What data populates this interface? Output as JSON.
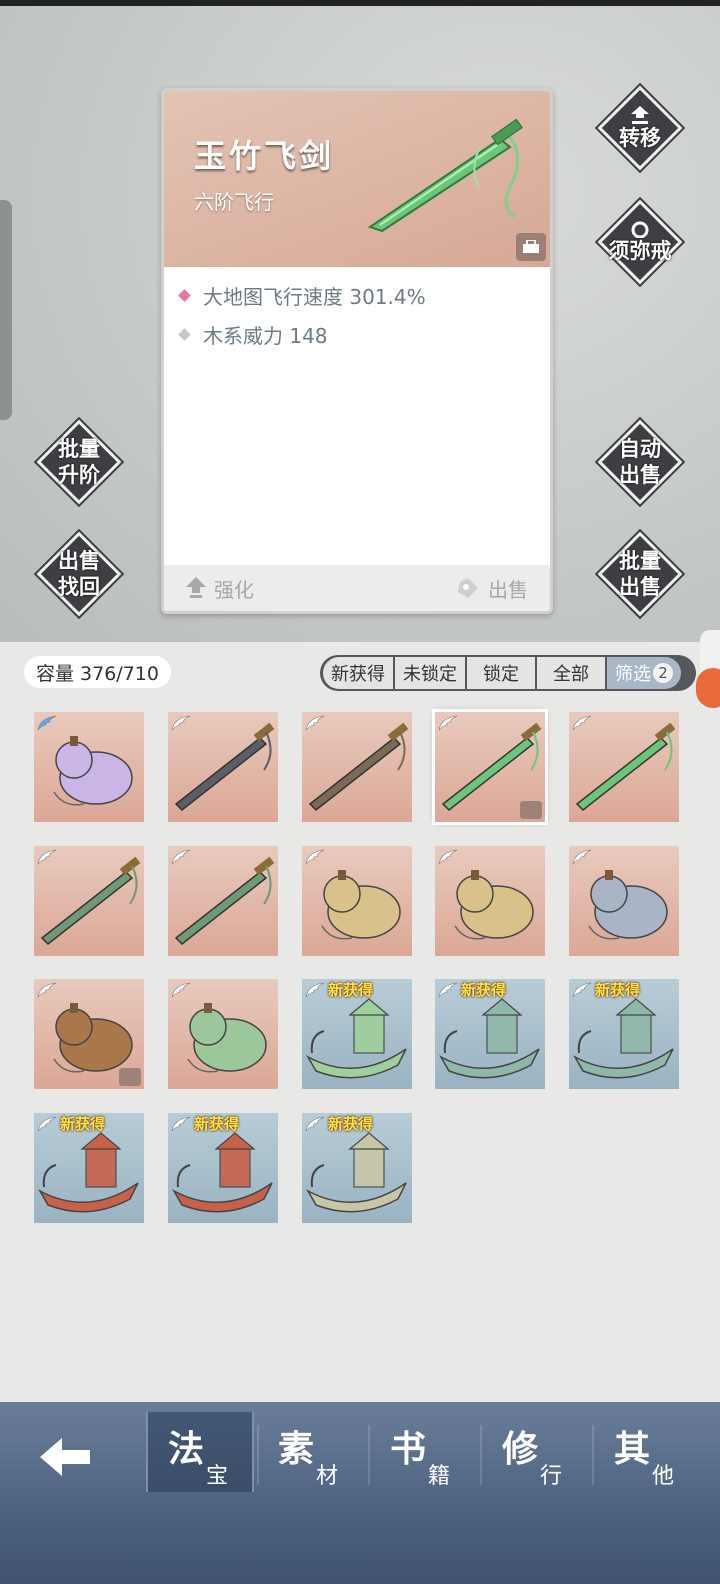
{
  "detail": {
    "name": "玉竹飞剑",
    "type": "六阶飞行",
    "stats": [
      {
        "text": "大地图飞行速度 301.4%",
        "color": "#e07aa8"
      },
      {
        "text": "木系威力 148",
        "color": "#c8c8c8"
      }
    ],
    "enhance_label": "强化",
    "sell_label": "出售"
  },
  "side_buttons": {
    "transfer": "转移",
    "sumeru_ring": "须弥戒",
    "batch_upgrade_1": "批量",
    "batch_upgrade_2": "升阶",
    "auto_sell_1": "自动",
    "auto_sell_2": "出售",
    "sell_recover_1": "出售",
    "sell_recover_2": "找回",
    "batch_sell_1": "批量",
    "batch_sell_2": "出售"
  },
  "inventory": {
    "capacity": "容量 376/710",
    "filters": [
      "新获得",
      "未锁定",
      "锁定",
      "全部",
      "筛选"
    ],
    "filter_count": "2",
    "new_tag": "新获得",
    "items": [
      {
        "icon": "gourd-purple-icon",
        "bg": "pink",
        "wing": "blue",
        "new": false,
        "locked": false
      },
      {
        "icon": "dark-sword-icon",
        "bg": "pink",
        "wing": "white",
        "new": false,
        "locked": false
      },
      {
        "icon": "bronze-sword-icon",
        "bg": "pink",
        "wing": "white",
        "new": false,
        "locked": false
      },
      {
        "icon": "jade-sword-icon",
        "bg": "pink",
        "wing": "white",
        "new": false,
        "locked": true,
        "selected": true
      },
      {
        "icon": "jade-sword-icon",
        "bg": "pink",
        "wing": "white",
        "new": false,
        "locked": false
      },
      {
        "icon": "green-sword-icon",
        "bg": "pink",
        "wing": "white",
        "new": false,
        "locked": false
      },
      {
        "icon": "green-sword-icon",
        "bg": "pink",
        "wing": "white",
        "new": false,
        "locked": false
      },
      {
        "icon": "golden-gourd-icon",
        "bg": "pink",
        "wing": "white",
        "new": false,
        "locked": false
      },
      {
        "icon": "golden-gourd-icon",
        "bg": "pink",
        "wing": "white",
        "new": false,
        "locked": false
      },
      {
        "icon": "blue-gourd-icon",
        "bg": "pink",
        "wing": "white",
        "new": false,
        "locked": false
      },
      {
        "icon": "wine-gourd-icon",
        "bg": "pink",
        "wing": "white",
        "new": false,
        "locked": true
      },
      {
        "icon": "green-gourd-icon",
        "bg": "pink",
        "wing": "white",
        "new": false,
        "locked": false
      },
      {
        "icon": "jade-boat-icon",
        "bg": "blue",
        "wing": "white",
        "new": true,
        "locked": false
      },
      {
        "icon": "pavilion-boat-icon",
        "bg": "blue",
        "wing": "white",
        "new": true,
        "locked": false
      },
      {
        "icon": "pavilion-boat-icon",
        "bg": "blue",
        "wing": "white",
        "new": true,
        "locked": false
      },
      {
        "icon": "red-boat-icon",
        "bg": "blue",
        "wing": "white",
        "new": true,
        "locked": false
      },
      {
        "icon": "red-boat-icon",
        "bg": "blue",
        "wing": "white",
        "new": true,
        "locked": false
      },
      {
        "icon": "dragon-boat-icon",
        "bg": "blue",
        "wing": "white",
        "new": true,
        "locked": false
      }
    ]
  },
  "nav": {
    "tabs": [
      {
        "big": "法",
        "small": "宝"
      },
      {
        "big": "素",
        "small": "材"
      },
      {
        "big": "书",
        "small": "籍"
      },
      {
        "big": "修",
        "small": "行"
      },
      {
        "big": "其",
        "small": "他"
      }
    ]
  }
}
